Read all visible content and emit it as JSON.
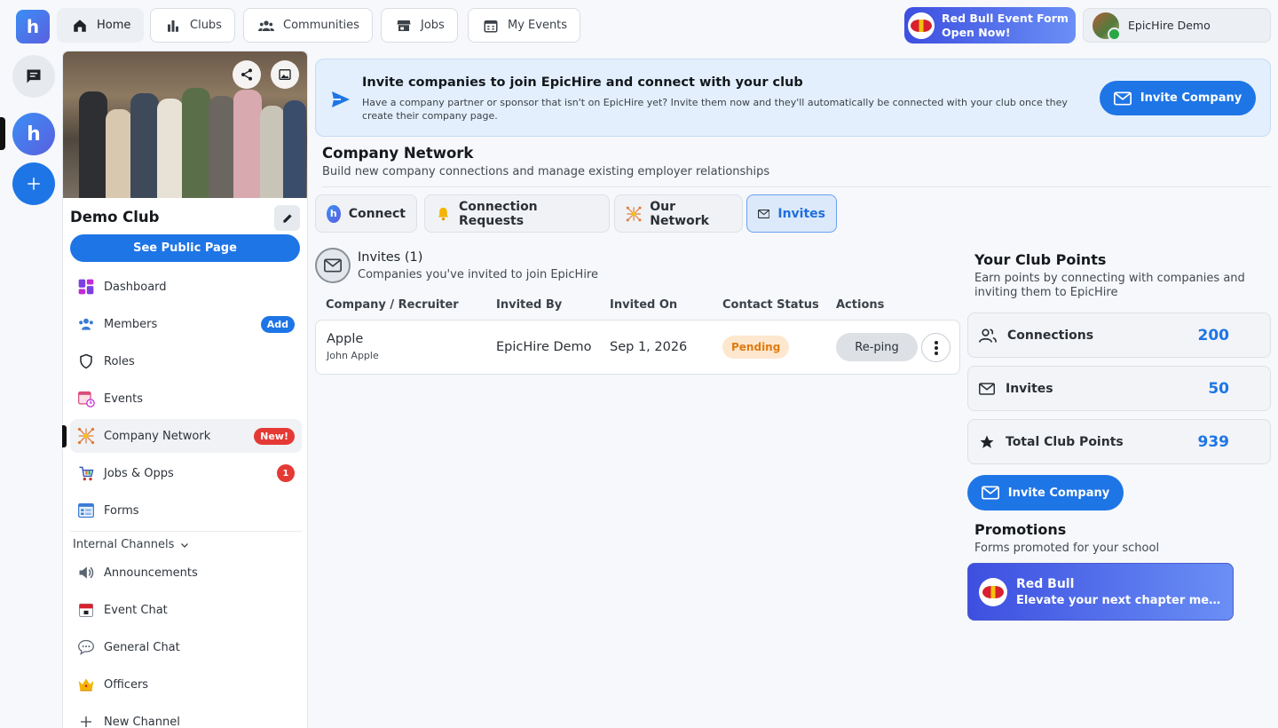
{
  "nav": {
    "tabs": [
      {
        "label": "Home",
        "icon": "home-icon"
      },
      {
        "label": "Clubs",
        "icon": "bar-chart-icon"
      },
      {
        "label": "Communities",
        "icon": "people-icon"
      },
      {
        "label": "Jobs",
        "icon": "store-icon"
      },
      {
        "label": "My Events",
        "icon": "calendar-icon"
      }
    ],
    "promo": {
      "line1": "Red Bull Event Form",
      "line2": "Open Now!"
    },
    "user": {
      "name": "EpicHire Demo"
    }
  },
  "sidebar": {
    "club_name": "Demo Club",
    "public_button": "See Public Page",
    "items": [
      {
        "label": "Dashboard"
      },
      {
        "label": "Members",
        "badge": "Add"
      },
      {
        "label": "Roles"
      },
      {
        "label": "Events"
      },
      {
        "label": "Company Network",
        "badge": "New!"
      },
      {
        "label": "Jobs & Opps",
        "badge": "1"
      },
      {
        "label": "Forms"
      }
    ],
    "section_label": "Internal Channels",
    "channels": [
      {
        "label": "Announcements"
      },
      {
        "label": "Event Chat"
      },
      {
        "label": "General Chat"
      },
      {
        "label": "Officers"
      },
      {
        "label": "New Channel"
      }
    ]
  },
  "banner": {
    "title": "Invite companies to join EpicHire and connect with your club",
    "desc": "Have a company partner or sponsor that isn't on EpicHire yet? Invite them now and they'll automatically be connected with your club once they create their company page.",
    "button": "Invite Company"
  },
  "page": {
    "title": "Company Network",
    "subtitle": "Build new company connections and manage existing employer relationships"
  },
  "tabs": [
    {
      "label": "Connect"
    },
    {
      "label": "Connection Requests"
    },
    {
      "label": "Our Network"
    },
    {
      "label": "Invites"
    }
  ],
  "invites": {
    "title": "Invites (1)",
    "subtitle": "Companies you've invited to join EpicHire",
    "headers": [
      "Company / Recruiter",
      "Invited By",
      "Invited On",
      "Contact Status",
      "Actions"
    ],
    "rows": [
      {
        "company": "Apple",
        "recruiter": "John Apple",
        "invited_by": "EpicHire Demo",
        "invited_on": "Sep 1, 2026",
        "status": "Pending",
        "action": "Re-ping"
      }
    ]
  },
  "points": {
    "title": "Your Club Points",
    "desc": "Earn points by connecting with companies and inviting them to EpicHire",
    "stats": [
      {
        "label": "Connections",
        "value": "200"
      },
      {
        "label": "Invites",
        "value": "50"
      },
      {
        "label": "Total Club Points",
        "value": "939"
      }
    ],
    "button": "Invite Company"
  },
  "promotions": {
    "title": "Promotions",
    "subtitle": "Forms promoted for your school",
    "card": {
      "name": "Red Bull",
      "desc": "Elevate your next chapter meetin..."
    }
  },
  "colors": {
    "primary": "#1e75e6",
    "pending_bg": "#fde7cf",
    "pending_text": "#e07b0f",
    "badge_red": "#e53935"
  }
}
